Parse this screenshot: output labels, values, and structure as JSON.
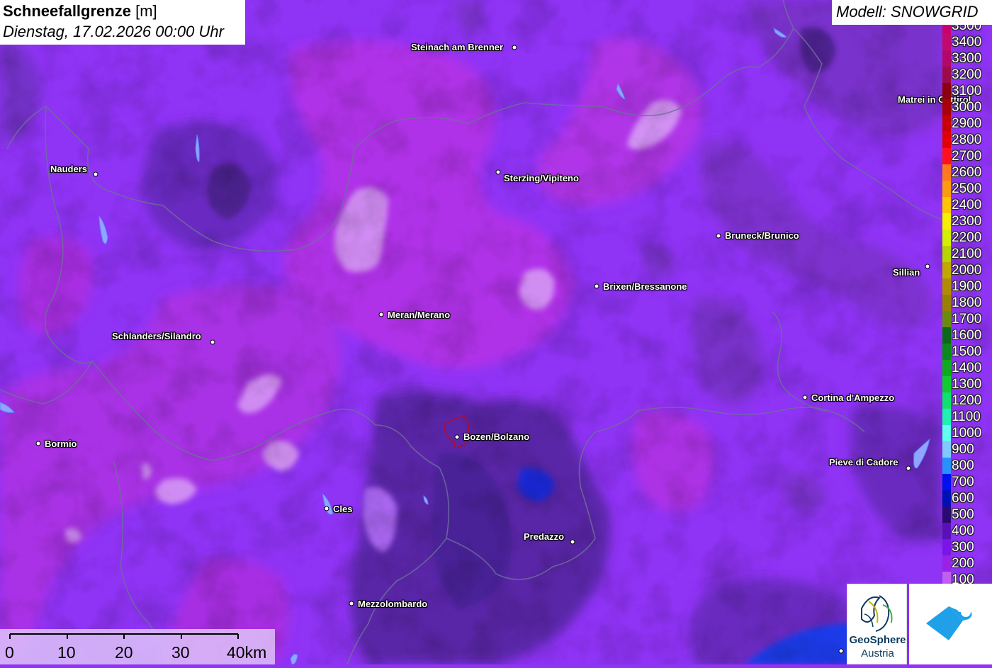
{
  "title": {
    "variable": "Schneefallgrenze",
    "unit": "[m]",
    "datetime": "Dienstag, 17.02.2026 00:00 Uhr"
  },
  "model": "Modell: SNOWGRID",
  "legend": {
    "entries": [
      {
        "label": "3500",
        "color": "#c8006e"
      },
      {
        "label": "3400",
        "color": "#c10a70"
      },
      {
        "label": "3300",
        "color": "#b0086b"
      },
      {
        "label": "3200",
        "color": "#9c0c4a"
      },
      {
        "label": "3100",
        "color": "#8b0010"
      },
      {
        "label": "3000",
        "color": "#a8000c"
      },
      {
        "label": "2900",
        "color": "#c80008"
      },
      {
        "label": "2800",
        "color": "#e0000a"
      },
      {
        "label": "2700",
        "color": "#ff1020"
      },
      {
        "label": "2600",
        "color": "#ff7a1e"
      },
      {
        "label": "2500",
        "color": "#ff9a10"
      },
      {
        "label": "2400",
        "color": "#ffc400"
      },
      {
        "label": "2300",
        "color": "#f5f000"
      },
      {
        "label": "2200",
        "color": "#d2f000"
      },
      {
        "label": "2100",
        "color": "#b8d400"
      },
      {
        "label": "2000",
        "color": "#c0a800"
      },
      {
        "label": "1900",
        "color": "#b08c00"
      },
      {
        "label": "1800",
        "color": "#9a8000"
      },
      {
        "label": "1700",
        "color": "#6a8a10"
      },
      {
        "label": "1600",
        "color": "#0a6a18"
      },
      {
        "label": "1500",
        "color": "#0a8a1a"
      },
      {
        "label": "1400",
        "color": "#10aa20"
      },
      {
        "label": "1300",
        "color": "#10cc30"
      },
      {
        "label": "1200",
        "color": "#10e070"
      },
      {
        "label": "1100",
        "color": "#20f0b0"
      },
      {
        "label": "1000",
        "color": "#60fff0"
      },
      {
        "label": "900",
        "color": "#80c8ff"
      },
      {
        "label": "800",
        "color": "#2890ff"
      },
      {
        "label": "700",
        "color": "#0010f0"
      },
      {
        "label": "600",
        "color": "#0010b8"
      },
      {
        "label": "500",
        "color": "#2a0a70"
      },
      {
        "label": "400",
        "color": "#5a10b8"
      },
      {
        "label": "300",
        "color": "#7a14e8"
      },
      {
        "label": "200",
        "color": "#9a22e6"
      },
      {
        "label": "100",
        "color": "#c060f0"
      }
    ]
  },
  "cities": [
    {
      "name": "Steinach am Brenner",
      "dot": [
        726,
        67
      ],
      "label": [
        580,
        59
      ]
    },
    {
      "name": "Nauders",
      "dot": [
        135,
        246
      ],
      "label": [
        71,
        231
      ]
    },
    {
      "name": "Sterzing/Vipiteno",
      "dot": [
        703,
        243
      ],
      "label": [
        711,
        244
      ]
    },
    {
      "name": "Matrei in Osttirol",
      "dot": [
        1500,
        150
      ],
      "label": [
        1267,
        133
      ]
    },
    {
      "name": "Bruneck/Brunico",
      "dot": [
        1014,
        333
      ],
      "label": [
        1023,
        325
      ]
    },
    {
      "name": "Sillian",
      "dot": [
        1309,
        376
      ],
      "label": [
        1260,
        377
      ]
    },
    {
      "name": "Brixen/Bressanone",
      "dot": [
        842,
        404
      ],
      "label": [
        851,
        397
      ]
    },
    {
      "name": "Meran/Merano",
      "dot": [
        538,
        444
      ],
      "label": [
        547,
        437
      ]
    },
    {
      "name": "Schlanders/Silandro",
      "dot": [
        300,
        483
      ],
      "label": [
        158,
        467
      ]
    },
    {
      "name": "Cortina d'Ampezzo",
      "dot": [
        1136,
        561
      ],
      "label": [
        1145,
        554
      ]
    },
    {
      "name": "Bormio",
      "dot": [
        54,
        626
      ],
      "label": [
        63,
        619
      ]
    },
    {
      "name": "Bozen/Bolzano",
      "dot": [
        645,
        617
      ],
      "label": [
        654,
        609
      ]
    },
    {
      "name": "Pieve di Cadore",
      "dot": [
        1282,
        661
      ],
      "label": [
        1170,
        645
      ]
    },
    {
      "name": "Cles",
      "dot": [
        461,
        718
      ],
      "label": [
        470,
        711
      ]
    },
    {
      "name": "Predazzo",
      "dot": [
        808,
        765
      ],
      "label": [
        739,
        750
      ]
    },
    {
      "name": "Mezzolombardo",
      "dot": [
        496,
        852
      ],
      "label": [
        505,
        845
      ]
    },
    {
      "name": "",
      "dot": [
        1187,
        919
      ],
      "label": [
        0,
        0
      ]
    }
  ],
  "scalebar": {
    "labels": [
      "0",
      "10",
      "20",
      "30",
      "40km"
    ]
  },
  "logos": {
    "geosphere_line1": "GeoSphere",
    "geosphere_line2": "Austria"
  }
}
